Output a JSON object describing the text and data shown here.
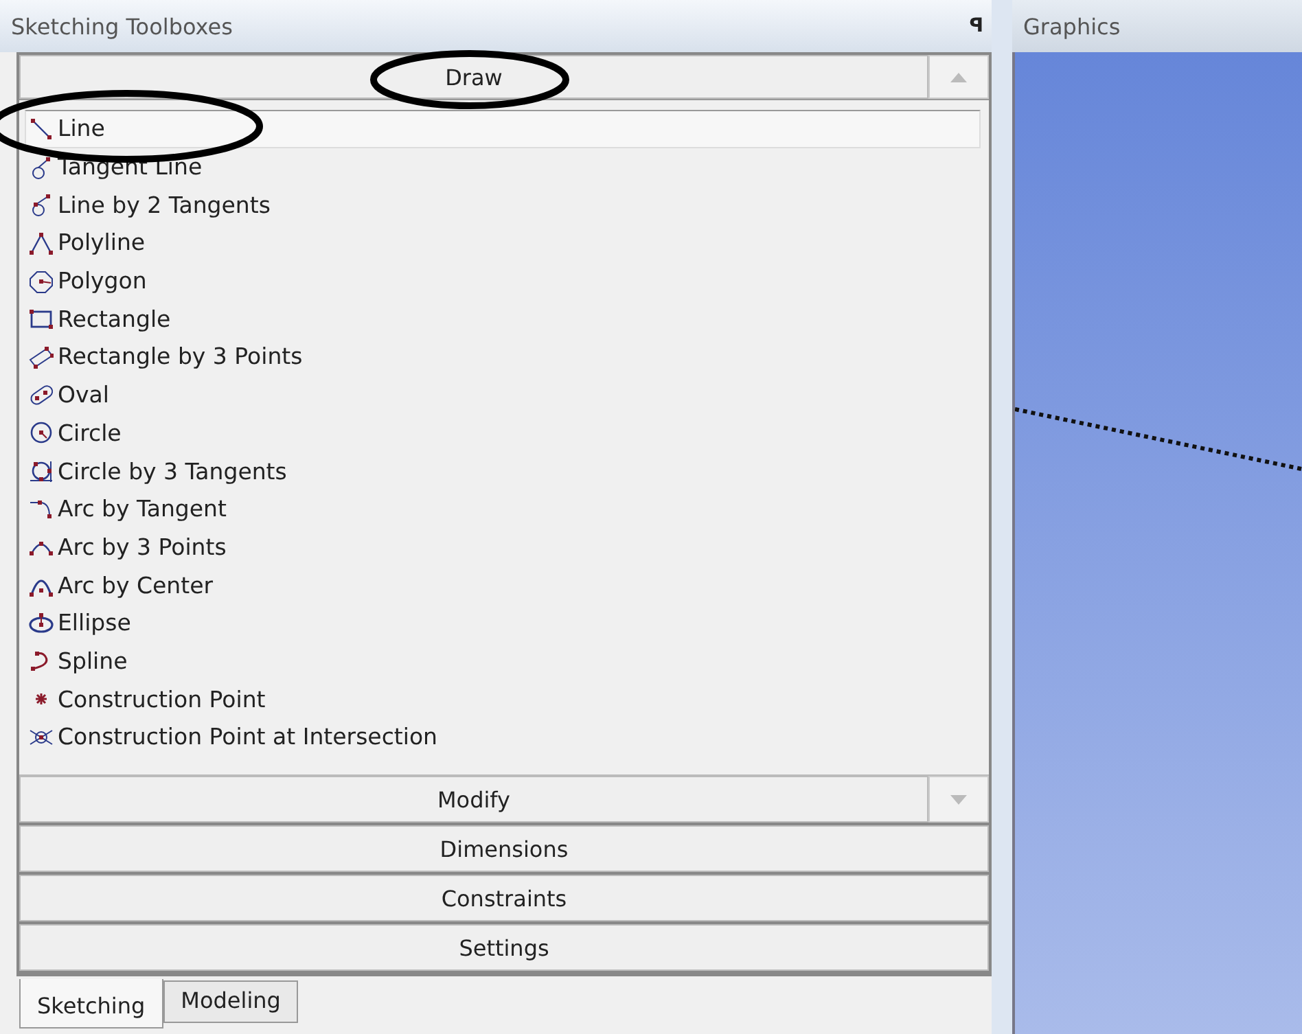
{
  "toolbox": {
    "title": "Sketching Toolboxes",
    "pin": "ꟼ",
    "open_section": {
      "label": "Draw",
      "items": [
        {
          "label": "Line",
          "selected": true
        },
        {
          "label": "Tangent Line",
          "selected": false
        },
        {
          "label": "Line by 2 Tangents",
          "selected": false
        },
        {
          "label": "Polyline",
          "selected": false
        },
        {
          "label": "Polygon",
          "selected": false
        },
        {
          "label": "Rectangle",
          "selected": false
        },
        {
          "label": "Rectangle by 3 Points",
          "selected": false
        },
        {
          "label": "Oval",
          "selected": false
        },
        {
          "label": "Circle",
          "selected": false
        },
        {
          "label": "Circle by 3 Tangents",
          "selected": false
        },
        {
          "label": "Arc by Tangent",
          "selected": false
        },
        {
          "label": "Arc by 3 Points",
          "selected": false
        },
        {
          "label": "Arc by Center",
          "selected": false
        },
        {
          "label": "Ellipse",
          "selected": false
        },
        {
          "label": "Spline",
          "selected": false
        },
        {
          "label": "Construction Point",
          "selected": false
        },
        {
          "label": "Construction Point at Intersection",
          "selected": false
        }
      ]
    },
    "sections": [
      {
        "label": "Modify"
      },
      {
        "label": "Dimensions"
      },
      {
        "label": "Constraints"
      },
      {
        "label": "Settings"
      }
    ],
    "tabs": [
      {
        "label": "Sketching",
        "selected": true
      },
      {
        "label": "Modeling",
        "selected": false
      }
    ]
  },
  "graphics": {
    "title": "Graphics"
  }
}
